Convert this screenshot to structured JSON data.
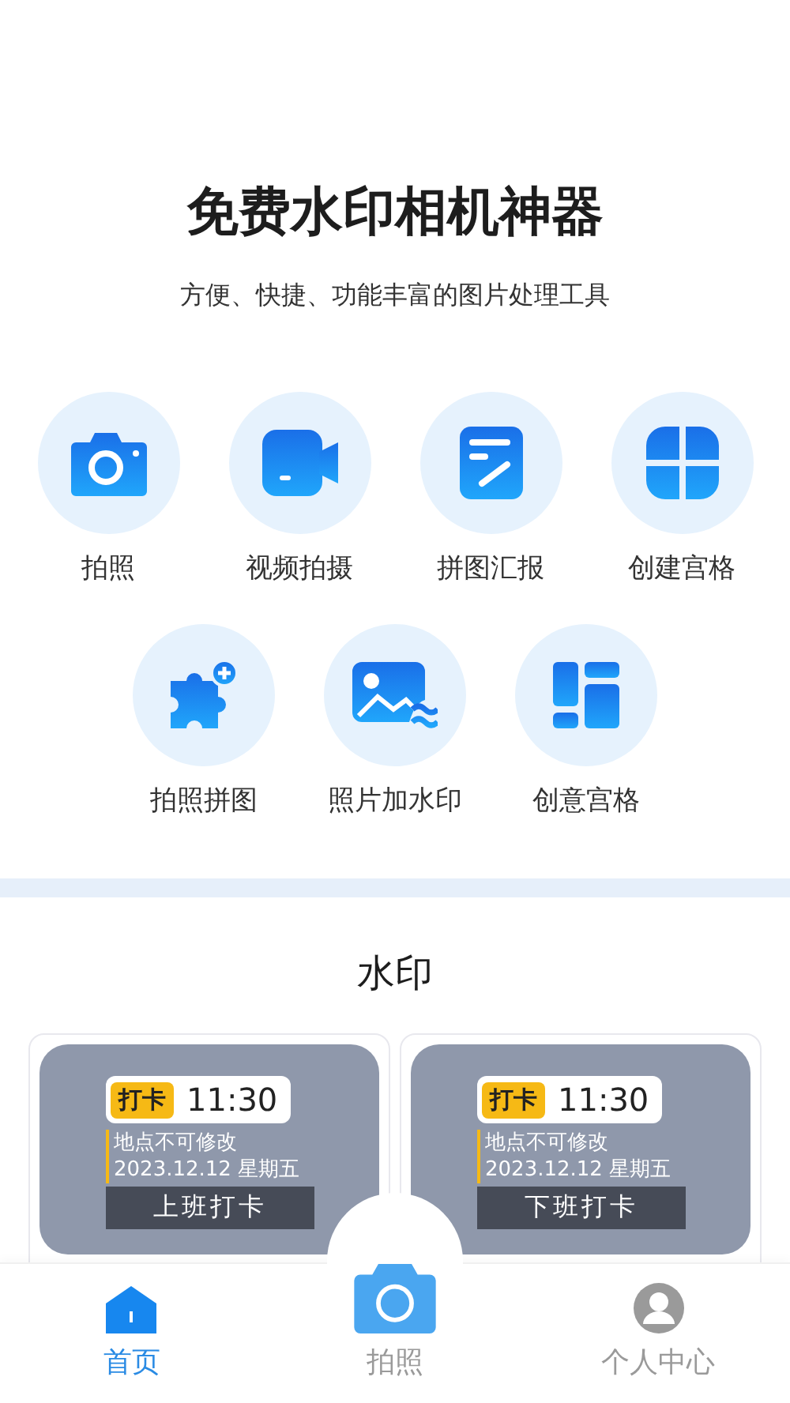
{
  "header": {
    "title": "免费水印相机神器",
    "subtitle": "方便、快捷、功能丰富的图片处理工具"
  },
  "features_row_1": [
    {
      "kind": "camera",
      "label": "拍照"
    },
    {
      "kind": "video",
      "label": "视频拍摄"
    },
    {
      "kind": "note",
      "label": "拼图汇报"
    },
    {
      "kind": "grid",
      "label": "创建宫格"
    }
  ],
  "features_row_2": [
    {
      "kind": "puzzle",
      "label": "拍照拼图"
    },
    {
      "kind": "image",
      "label": "照片加水印"
    },
    {
      "kind": "layout",
      "label": "创意宫格"
    }
  ],
  "watermark_section": {
    "title": "水印",
    "templates": [
      {
        "tag": "打卡",
        "time": "11:30",
        "location": "地点不可修改",
        "date": "2023.12.12 星期五",
        "button": "上班打卡"
      },
      {
        "tag": "打卡",
        "time": "11:30",
        "location": "地点不可修改",
        "date": "2023.12.12 星期五",
        "button": "下班打卡"
      }
    ]
  },
  "tab_bar": [
    {
      "kind": "home",
      "label": "首页",
      "selected": true
    },
    {
      "kind": "camera",
      "label": "拍照",
      "selected": false
    },
    {
      "kind": "profile",
      "label": "个人中心",
      "selected": false
    }
  ]
}
